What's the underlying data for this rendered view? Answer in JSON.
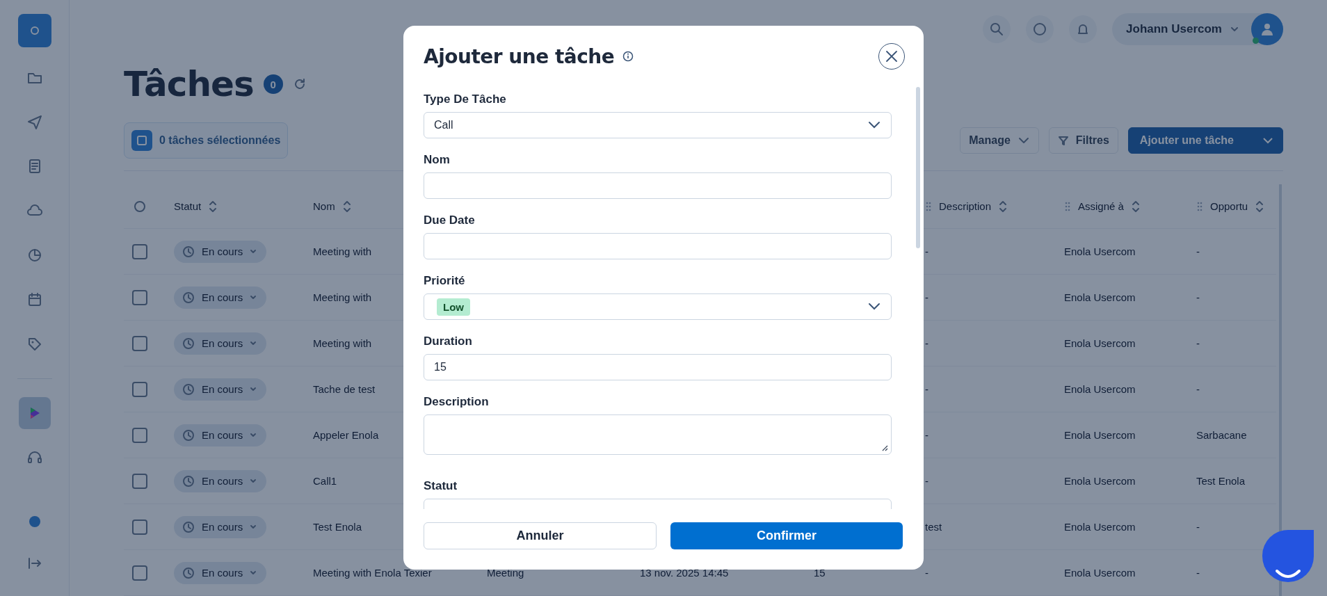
{
  "sidebar": {
    "items": [
      {
        "selected": false
      },
      {
        "selected": false
      },
      {
        "selected": false
      },
      {
        "selected": false
      },
      {
        "selected": false
      },
      {
        "selected": false
      },
      {
        "selected": false
      },
      {
        "selected": true
      },
      {
        "selected": false
      }
    ],
    "bottom_items": [
      {
        "selected": false
      },
      {
        "selected": false
      }
    ]
  },
  "header": {
    "user_name": "Johann Usercom",
    "online": true
  },
  "page": {
    "title": "Tâches",
    "count": "0"
  },
  "toolbar": {
    "selection": "0 tâches sélectionnées",
    "manage": "Manage",
    "filters": "Filtres",
    "add": "Ajouter une tâche"
  },
  "table": {
    "columns": {
      "status": {
        "label": "Statut",
        "draggable": false
      },
      "name": {
        "label": "Nom",
        "draggable": false
      },
      "description": {
        "label": "Description",
        "draggable": true
      },
      "assignee": {
        "label": "Assigné à",
        "draggable": true
      },
      "opportunity": {
        "label": "Opportu",
        "draggable": true
      }
    },
    "rows": [
      {
        "checked": false,
        "status": "En cours",
        "name": "Meeting with",
        "description": "-",
        "assignee": "Enola Usercom",
        "opportunity": "-"
      },
      {
        "checked": false,
        "status": "En cours",
        "name": "Meeting with",
        "description": "-",
        "assignee": "Enola Usercom",
        "opportunity": "-"
      },
      {
        "checked": false,
        "status": "En cours",
        "name": "Meeting with",
        "description": "-",
        "assignee": "Enola Usercom",
        "opportunity": "-"
      },
      {
        "checked": false,
        "status": "En cours",
        "name": "Tache de test",
        "description": "-",
        "assignee": "Enola Usercom",
        "opportunity": "-"
      },
      {
        "checked": false,
        "status": "En cours",
        "name": "Appeler Enola",
        "description": "-",
        "assignee": "Enola Usercom",
        "opportunity": "Sarbacane"
      },
      {
        "checked": false,
        "status": "En cours",
        "name": "Call1",
        "description": "-",
        "assignee": "Enola Usercom",
        "opportunity": "Test Enola"
      },
      {
        "checked": false,
        "status": "En cours",
        "name": "Test Enola",
        "description": "test",
        "assignee": "Enola Usercom",
        "opportunity": "-"
      },
      {
        "checked": false,
        "status": "En cours",
        "name": "Meeting with Enola Texier",
        "type": "Meeting",
        "due_date": "13 nov. 2025 14:45",
        "duration": "15",
        "description": "-",
        "assignee": "Enola Usercom",
        "opportunity": "-"
      }
    ]
  },
  "modal": {
    "title": "Ajouter une tâche",
    "fields": [
      {
        "label": "Type De Tâche",
        "kind": "select",
        "value": "Call"
      },
      {
        "label": "Nom",
        "kind": "text"
      },
      {
        "label": "Due Date",
        "kind": "text"
      },
      {
        "label": "Priorité",
        "kind": "tag-select",
        "value": "Low"
      },
      {
        "label": "Duration",
        "kind": "text",
        "value": "15"
      },
      {
        "label": "Description",
        "kind": "textarea"
      },
      {
        "label": "Statut",
        "kind": "text"
      }
    ],
    "cancel": "Annuler",
    "confirm": "Confirmer"
  }
}
